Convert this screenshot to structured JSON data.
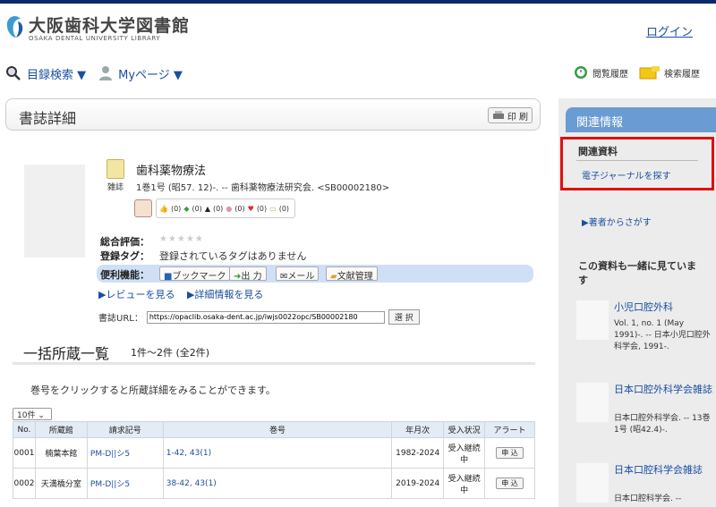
{
  "header": {
    "logo_title": "大阪歯科大学図書館",
    "logo_sub": "OSAKA DENTAL UNIVERSITY LIBRARY",
    "login": "ログイン"
  },
  "nav": {
    "catalog_search": "目録検索 ▼",
    "mypage": "Myページ ▼",
    "view_history": "閲覧履歴",
    "search_history": "検索履歴"
  },
  "page_title": "書誌詳細",
  "print_label": "印 刷",
  "record": {
    "material_type": "雑誌",
    "title": "歯科薬物療法",
    "info": "1巻1号 (昭57. 12)-. -- 歯科薬物療法研究会. <SB00002180>",
    "reactions": [
      "(0)",
      "(0)",
      "(0)",
      "(0)",
      "(0)",
      "(0)"
    ],
    "overall_label": "総合評価：",
    "stars": "★★★★★",
    "tags_label": "登録タグ：",
    "tags_value": "登録されているタグはありません",
    "func_label": "便利機能：",
    "func_buttons": [
      "ブックマーク",
      "出 力",
      "メール",
      "文献管理"
    ],
    "review_link": "▶レビューを見る",
    "detail_link": "▶詳細情報を見る",
    "url_label": "書誌URL：",
    "url_value": "https://opaclib.osaka-dent.ac.jp/iwjs0022opc/SB00002180",
    "url_select": "選 択"
  },
  "holdings": {
    "heading": "一括所蔵一覧",
    "count": "1件～2件 (全2件)",
    "note": "巻号をクリックすると所蔵詳細をみることができます。",
    "per_page": "10件 ⌄",
    "columns": [
      "No.",
      "所蔵館",
      "請求記号",
      "巻号",
      "年月次",
      "受入状況",
      "アラート"
    ],
    "rows": [
      {
        "no": "0001",
        "lib": "楠葉本館",
        "call": "PM-D||シ5",
        "vol": "1-42, 43(1)",
        "years": "1982-2024",
        "status": "受入継続中",
        "alert": "申 込"
      },
      {
        "no": "0002",
        "lib": "天満橋分室",
        "call": "PM-D||シ5",
        "vol": "38-42, 43(1)",
        "years": "2019-2024",
        "status": "受入継続中",
        "alert": "申 込"
      }
    ]
  },
  "sidebar": {
    "heading": "関連情報",
    "related_label": "関連資料",
    "ejournal_link": "電子ジャーナルを探す",
    "author_link": "▶著者からさがす",
    "also_heading": "この資料も一緒に見ています",
    "items": [
      {
        "title": "小児口腔外科",
        "info": "Vol. 1, no. 1 (May 1991)-. -- 日本小児口腔外科学会, 1991-."
      },
      {
        "title": "日本口腔外科学会雑誌",
        "info": "日本口腔外科学会. -- 13巻1号 (昭42.4)-."
      },
      {
        "title": "日本口腔科学会雑誌",
        "info": "日本口腔科学会. --"
      }
    ]
  }
}
